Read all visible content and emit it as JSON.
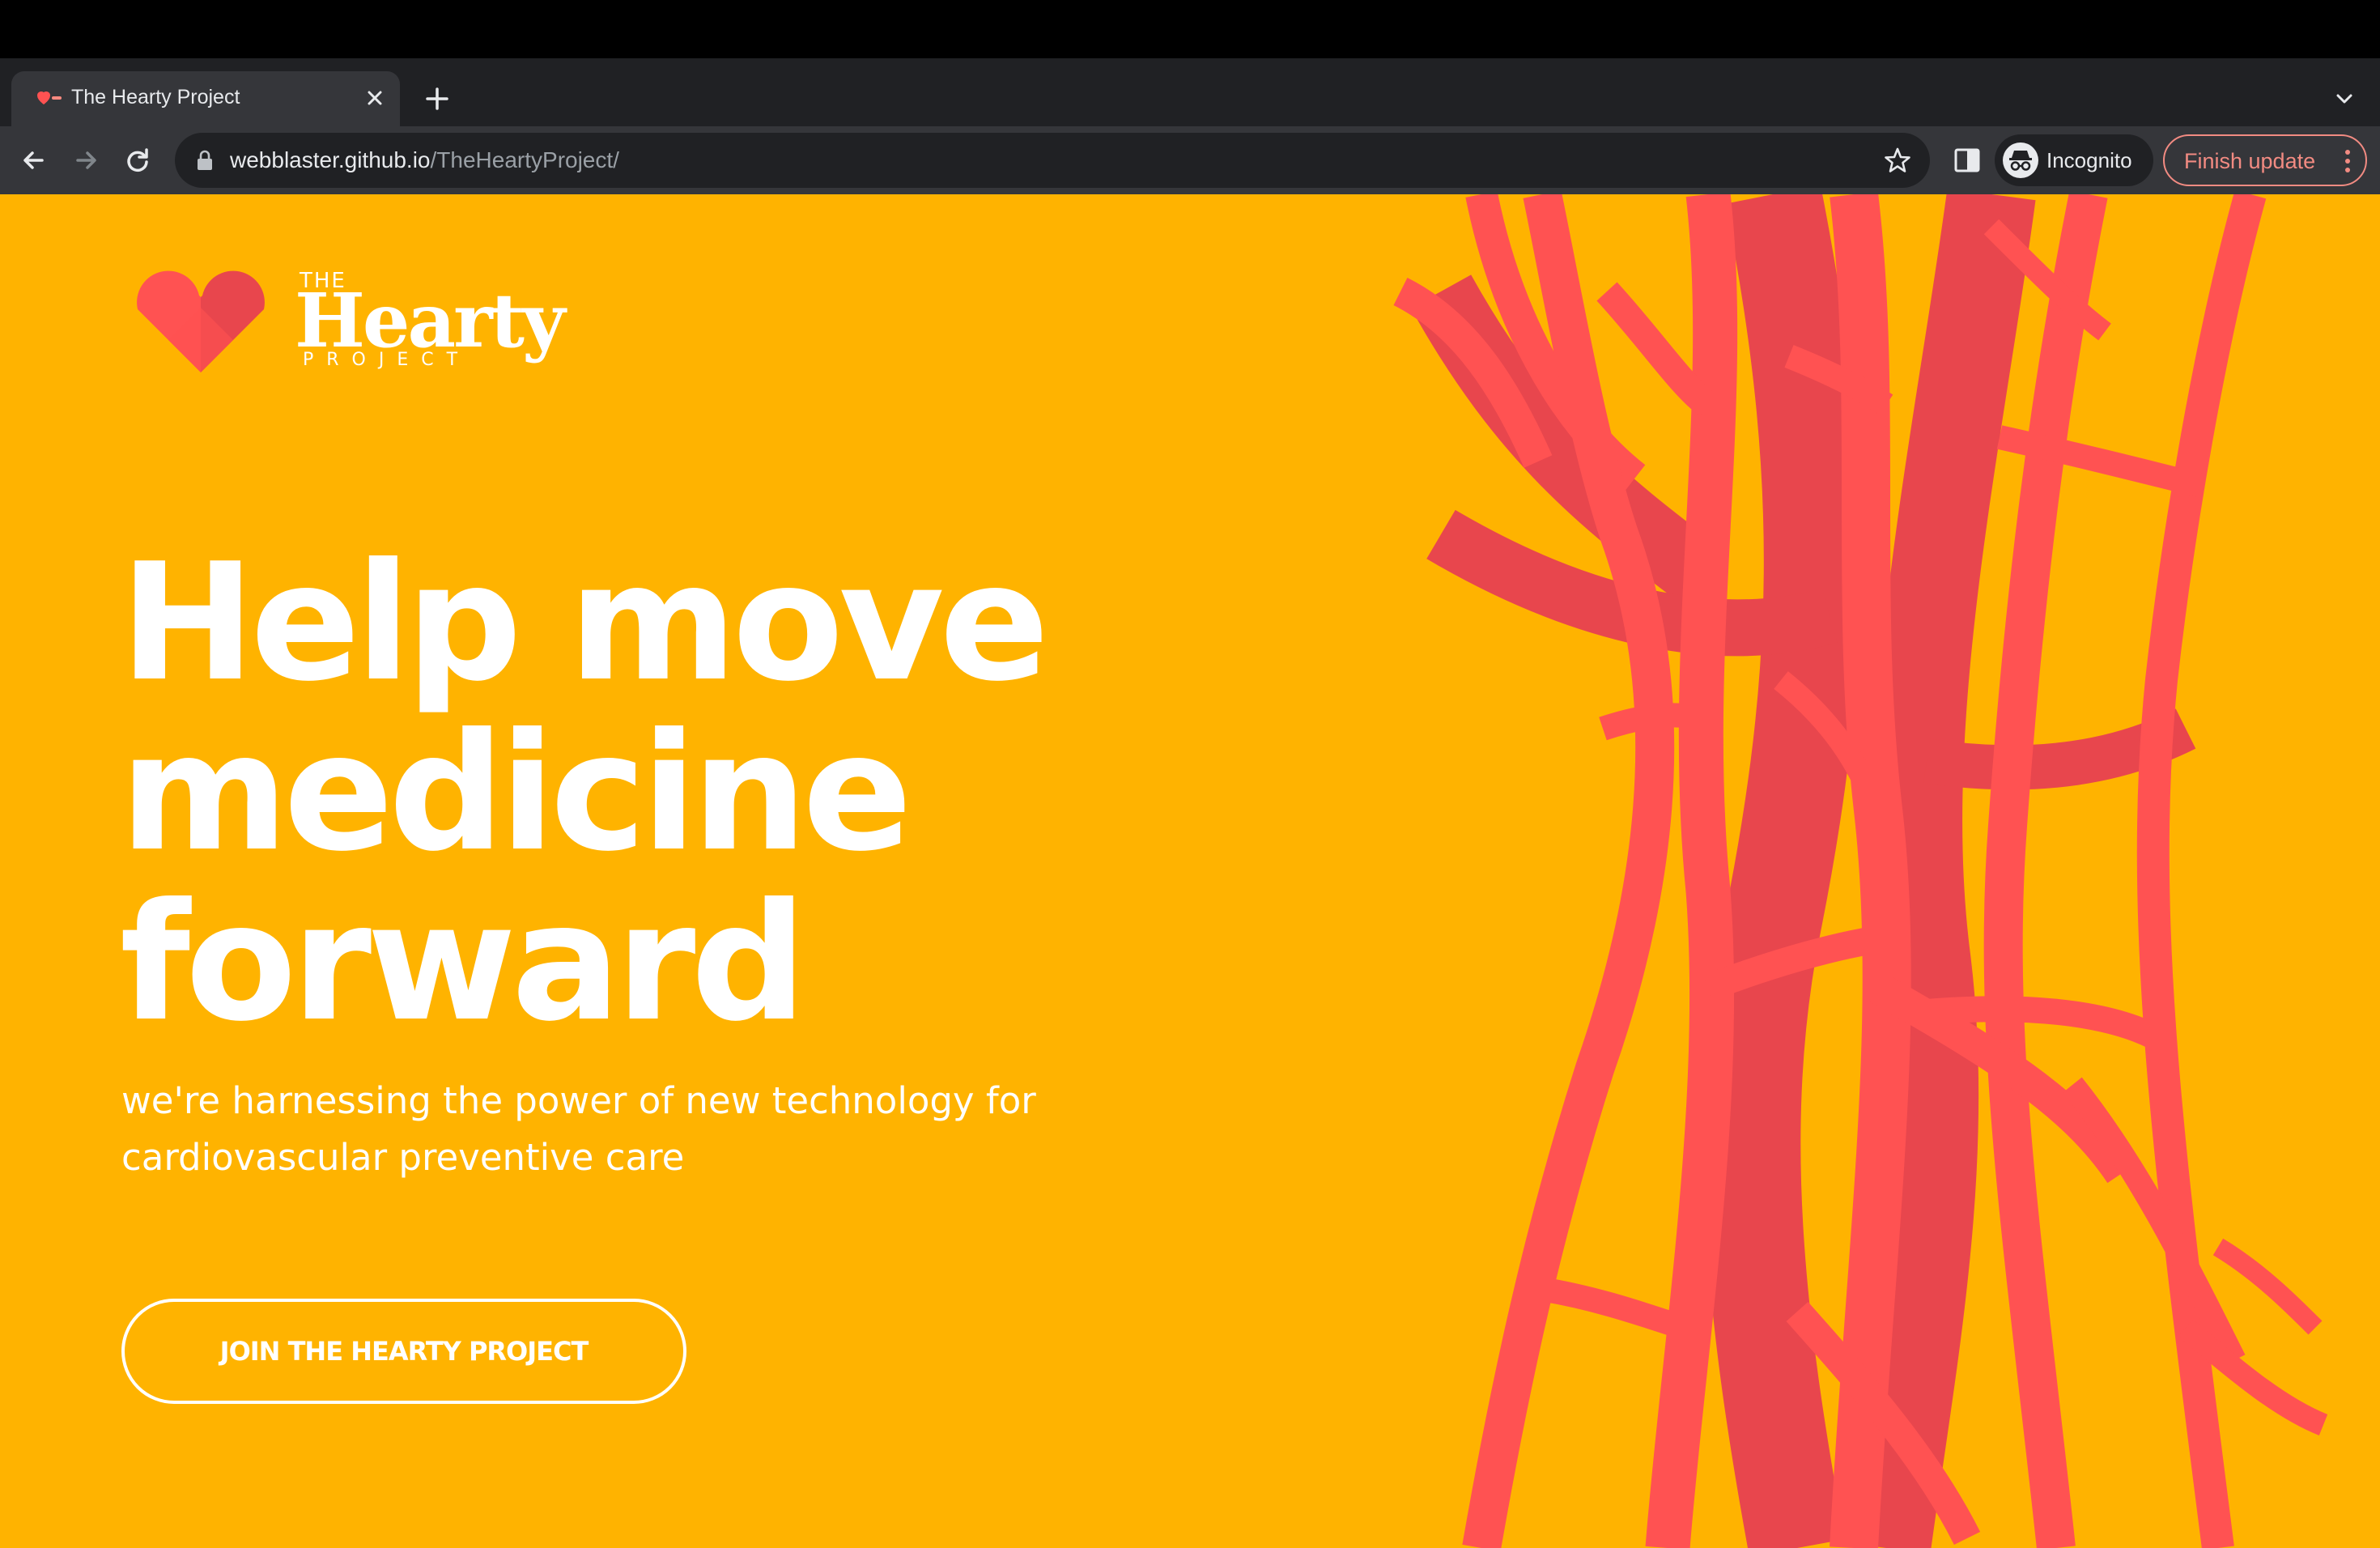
{
  "browser": {
    "tab_title": "The Hearty Project",
    "url_host": "webblaster.github.io",
    "url_path": "/TheHeartyProject/",
    "incognito_label": "Incognito",
    "update_label": "Finish update"
  },
  "logo": {
    "the": "THE",
    "name": "Hearty",
    "project": "PROJECT"
  },
  "hero": {
    "headline_lines": [
      "Help move",
      "medicine",
      "forward"
    ],
    "subtitle_lines": [
      "we're harnessing the power of new technology for",
      "cardiovascular preventive care"
    ],
    "cta_label": "JOIN THE HEARTY PROJECT"
  },
  "colors": {
    "page_background": "#FFB300",
    "vessel_light": "#FF5252",
    "vessel_dark": "#E8464D",
    "text": "#FFFFFF",
    "chrome_dark": "#202124",
    "chrome_toolbar": "#35363a",
    "update_accent": "#f28b82"
  },
  "icons": {
    "back": "arrow-left-icon",
    "forward": "arrow-right-icon",
    "reload": "reload-icon",
    "lock": "lock-icon",
    "bookmark": "star-icon",
    "side_panel": "side-panel-icon",
    "incognito": "incognito-icon",
    "menu": "kebab-menu-icon",
    "new_tab": "plus-icon",
    "tab_close": "close-icon",
    "tab_list": "chevron-down-icon"
  }
}
